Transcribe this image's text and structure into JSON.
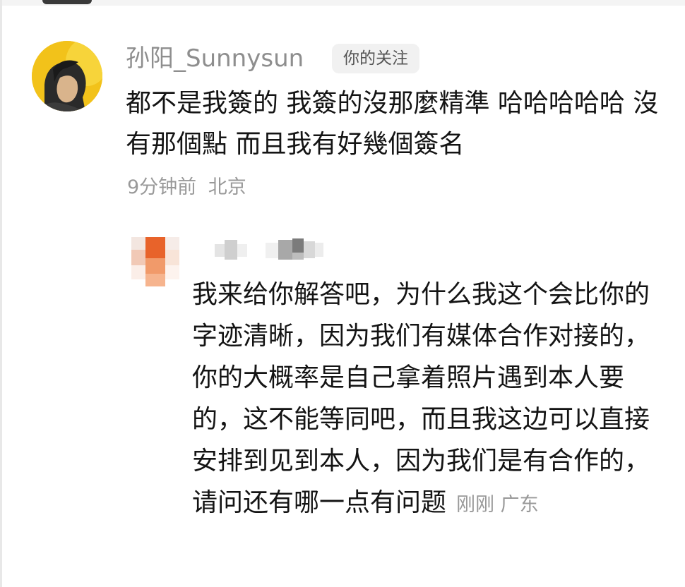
{
  "main_comment": {
    "username": "孙阳_Sunnysun",
    "badge": "你的关注",
    "text": "都不是我簽的 我簽的沒那麼精準 哈哈哈哈哈 沒有那個點 而且我有好幾個簽名",
    "time": "9分钟前",
    "location": "北京"
  },
  "reply": {
    "text": "我来给你解答吧，为什么我这个会比你的字迹清晰，因为我们有媒体合作对接的，你的大概率是自己拿着照片遇到本人要的，这不能等同吧，而且我这边可以直接安排到见到本人，因为我们是有合作的，请问还有哪一点有问题",
    "time": "刚刚",
    "location": "广东"
  },
  "colors": {
    "avatar_bg": "#f2c21a",
    "reply_avatar_accent": "#e8632a",
    "text_primary": "#141414",
    "text_secondary": "#999999"
  }
}
